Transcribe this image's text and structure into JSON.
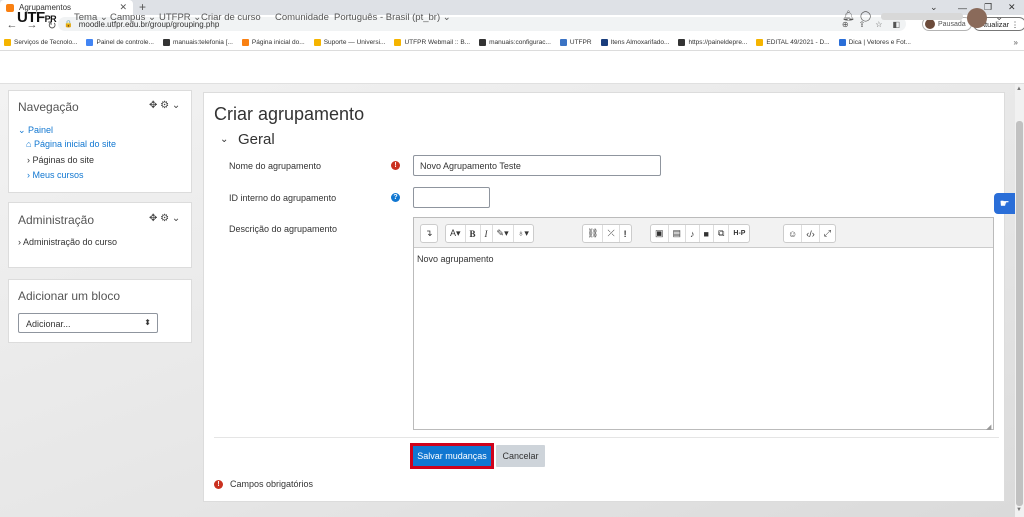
{
  "browser": {
    "tab_title": "Agrupamentos",
    "tab_close": "✕",
    "new_tab": "+",
    "window_controls": [
      "⌄",
      "—",
      "❐",
      "✕"
    ],
    "url": "moodle.utfpr.edu.br/group/grouping.php",
    "profile_status": "Pausada",
    "update_label": "Atualizar",
    "bookmarks": [
      {
        "label": "Serviços de Tecnolo...",
        "color": "#f5b400"
      },
      {
        "label": "Painel de controle...",
        "color": "#4285f4"
      },
      {
        "label": "manuais:telefonia [...",
        "color": "#333333"
      },
      {
        "label": "Página inicial do...",
        "color": "#f98012"
      },
      {
        "label": "Suporte — Universi...",
        "color": "#f5b400"
      },
      {
        "label": "UTFPR Webmail :: B...",
        "color": "#f5b400"
      },
      {
        "label": "manuais:configurac...",
        "color": "#333333"
      },
      {
        "label": "UTFPR",
        "color": "#3b73c4"
      },
      {
        "label": "Itens Almoxarifado...",
        "color": "#1a3d7c"
      },
      {
        "label": "https://paineldepre...",
        "color": "#333333"
      },
      {
        "label": "EDITAL 49/2021 - D...",
        "color": "#f5b400"
      },
      {
        "label": "Dica | Vetores e Fot...",
        "color": "#2a6ed8"
      }
    ],
    "bookmarks_more": "»"
  },
  "moodle": {
    "logo_main": "UTF",
    "logo_small": "PR",
    "nav": [
      {
        "label": "Tema ⌄"
      },
      {
        "label": "Campus ⌄"
      },
      {
        "label": "UTFPR ⌄"
      },
      {
        "label": "Criar de curso"
      },
      {
        "label": "Comunidade"
      },
      {
        "label": "Português - Brasil (pt_br) ⌄"
      }
    ],
    "user_menu_caret": "⌄"
  },
  "blocks": {
    "navigation": {
      "title": "Navegação",
      "controls": "✥ ⚙ ⌄",
      "items": [
        {
          "label": "⌄ Painel"
        },
        {
          "label": "Página inicial do site"
        },
        {
          "label": "› Páginas do site"
        },
        {
          "label": "› Meus cursos"
        }
      ]
    },
    "administration": {
      "title": "Administração",
      "controls": "✥ ⚙ ⌄",
      "item": "› Administração do curso"
    },
    "add_block": {
      "title": "Adicionar um bloco",
      "select_value": "Adicionar..."
    }
  },
  "form": {
    "heading": "Criar agrupamento",
    "legend": "Geral",
    "fields": {
      "name": {
        "label": "Nome do agrupamento",
        "value": "Novo Agrupamento Teste"
      },
      "idnumber": {
        "label": "ID interno do agrupamento",
        "value": ""
      },
      "description": {
        "label": "Descrição do agrupamento",
        "value": "Novo agrupamento"
      }
    },
    "save_label": "Salvar mudanças",
    "cancel_label": "Cancelar",
    "required_note": "Campos obrigatórios"
  },
  "colors": {
    "accent": "#1177d1",
    "required": "#ca3120",
    "highlight": "#d0021b"
  }
}
